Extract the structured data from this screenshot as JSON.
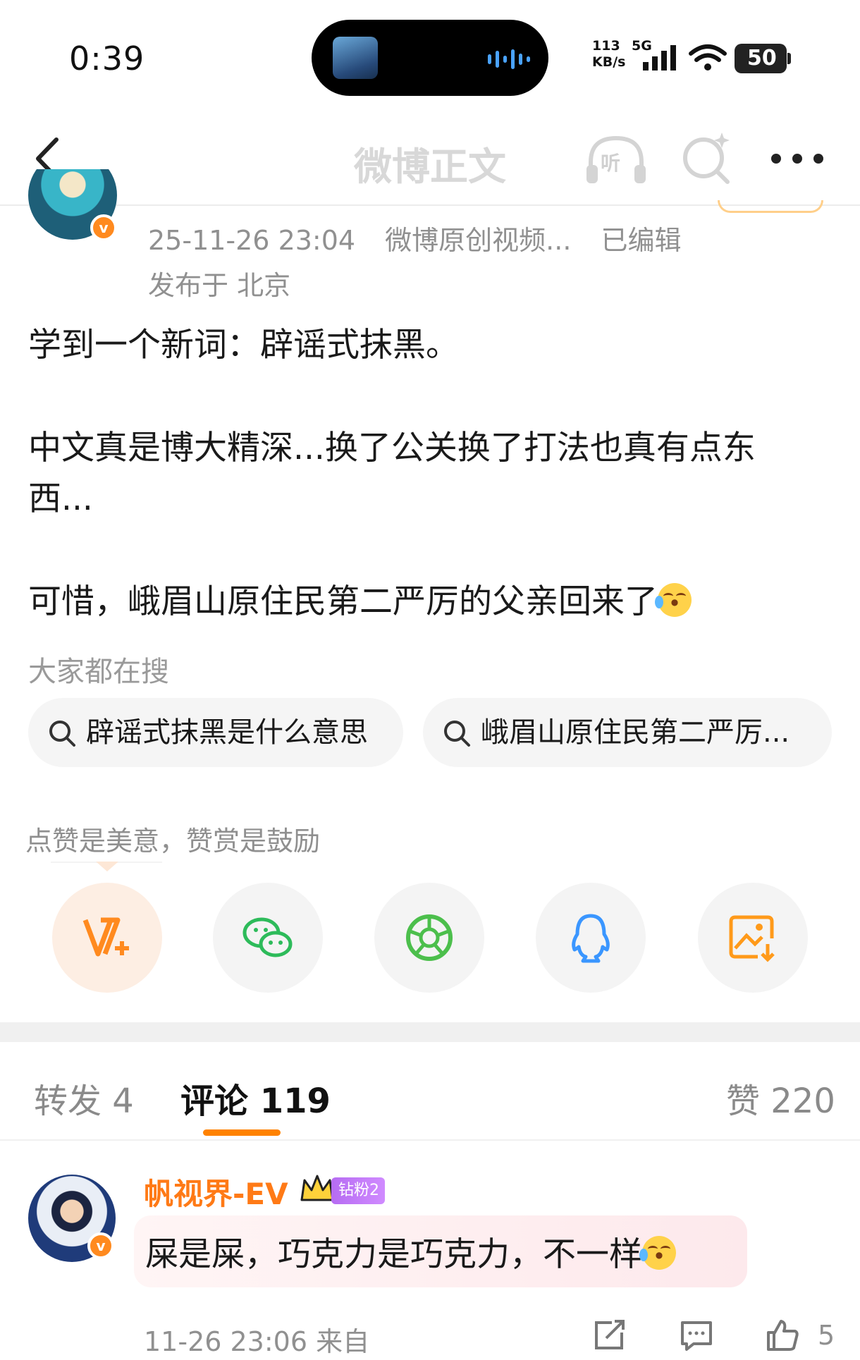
{
  "status_bar": {
    "time": "0:39",
    "net_speed_top": "113",
    "net_speed_bottom": "KB/s",
    "network": "5G",
    "battery": "50"
  },
  "nav": {
    "title": "微博正文",
    "listen_label": "听"
  },
  "post": {
    "date": "25-11-26 23:04",
    "source": "微博原创视频...",
    "edited": "已编辑",
    "location": "发布于 北京",
    "line1": "学到一个新词：辟谣式抹黑。",
    "line2": "中文真是博大精深...换了公关换了打法也真有点东",
    "line3": "西...",
    "line4": "可惜，峨眉山原住民第二严厉的父亲回来了"
  },
  "hot_search": {
    "title": "大家都在搜",
    "chips": [
      "辟谣式抹黑是什么意思",
      "峨眉山原住民第二严厉..."
    ]
  },
  "reward": {
    "hint": "点赞是美意，赞赏是鼓励",
    "buttons": [
      "v-plus-icon",
      "wechat-icon",
      "moments-icon",
      "qq-icon",
      "save-image-icon"
    ]
  },
  "tabs": {
    "repost": "转发 4",
    "comments": "评论 119",
    "likes": "赞 220"
  },
  "comment": {
    "author": "帆视界-EV",
    "badge": "钻粉2",
    "text": "屎是屎，巧克力是巧克力，不一样",
    "time": "11-26 23:06 来自",
    "like_count": "5"
  },
  "colors": {
    "accent": "#ff8200",
    "verified": "#ff8a1f",
    "fan_badge": "#c07cf6",
    "wechat": "#2dbb5a",
    "qq": "#3a96ff"
  }
}
